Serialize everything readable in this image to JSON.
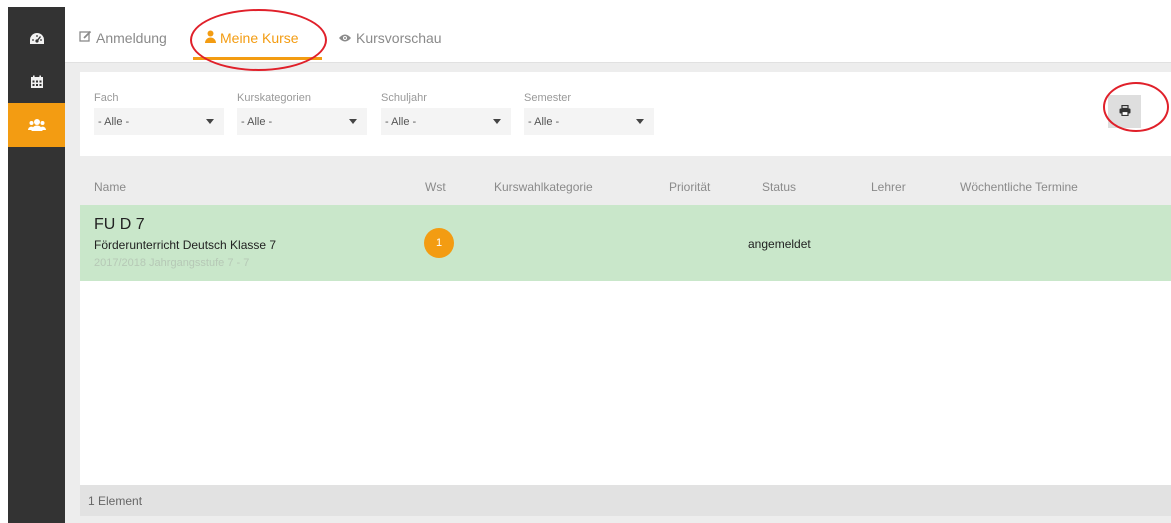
{
  "sidebar": {
    "items": [
      {
        "icon": "dashboard-icon",
        "active": false
      },
      {
        "icon": "calendar-icon",
        "active": false
      },
      {
        "icon": "users-icon",
        "active": true
      }
    ]
  },
  "tabs": [
    {
      "label": "Anmeldung",
      "icon": "edit-icon",
      "active": false
    },
    {
      "label": "Meine Kurse",
      "icon": "user-icon",
      "active": true
    },
    {
      "label": "Kursvorschau",
      "icon": "eye-icon",
      "active": false
    }
  ],
  "filters": [
    {
      "label": "Fach",
      "value": "- Alle -"
    },
    {
      "label": "Kurskategorien",
      "value": "- Alle -"
    },
    {
      "label": "Schuljahr",
      "value": "- Alle -"
    },
    {
      "label": "Semester",
      "value": "- Alle -"
    }
  ],
  "print": {
    "icon": "print-icon"
  },
  "table": {
    "columns": [
      "Name",
      "Wst",
      "Kurswahlkategorie",
      "Priorität",
      "Status",
      "Lehrer",
      "Wöchentliche Termine"
    ],
    "rows": [
      {
        "code": "FU D 7",
        "name": "Förderunterricht Deutsch Klasse 7",
        "meta": "2017/2018 Jahrgangsstufe 7 - 7",
        "wst": "1",
        "kurswahlkategorie": "",
        "prioritaet": "",
        "status": "angemeldet",
        "lehrer": "",
        "termine": ""
      }
    ],
    "footer": "1 Element"
  },
  "colors": {
    "accent": "#f39c12",
    "sidebar": "#333333",
    "row_highlight": "#c9e7ca",
    "annotation": "#e0202a"
  }
}
